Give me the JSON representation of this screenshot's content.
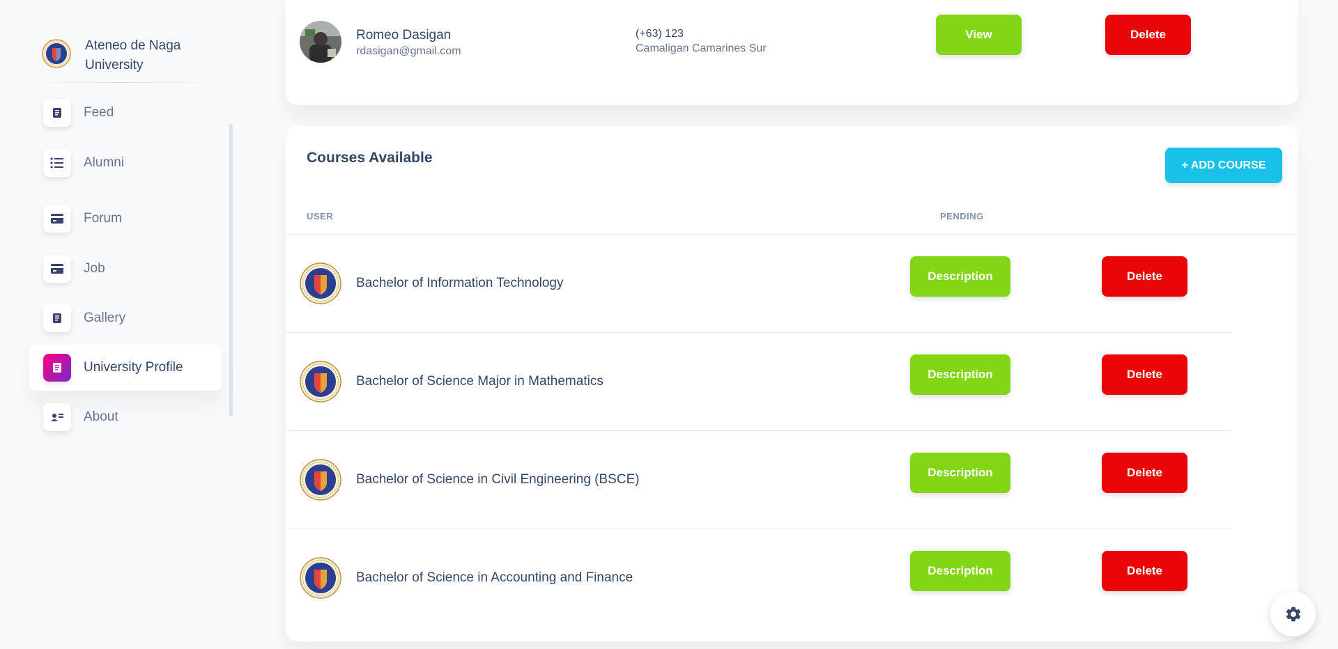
{
  "brand": {
    "name": "Ateneo de Naga University"
  },
  "sidebar": {
    "items": [
      {
        "label": "Feed",
        "icon": "document-icon",
        "active": false
      },
      {
        "label": "Alumni",
        "icon": "list-icon",
        "active": false
      },
      {
        "label": "Forum",
        "icon": "credit-card-icon",
        "active": false
      },
      {
        "label": "Job",
        "icon": "credit-card-icon",
        "active": false
      },
      {
        "label": "Gallery",
        "icon": "document-icon",
        "active": false
      },
      {
        "label": "University Profile",
        "icon": "document-icon",
        "active": true
      },
      {
        "label": "About",
        "icon": "contact-card-icon",
        "active": false
      }
    ]
  },
  "alumni_row": {
    "name": "Romeo Dasigan",
    "email": "rdasigan@gmail.com",
    "phone": "(+63) 123",
    "address": "Camaligan Camarines Sur",
    "view_label": "View",
    "delete_label": "Delete"
  },
  "courses": {
    "title": "Courses Available",
    "add_label": "+ ADD COURSE",
    "headers": {
      "user": "USER",
      "pending": "PENDING"
    },
    "rows": [
      {
        "name": "Bachelor of Information Technology",
        "description_label": "Description",
        "delete_label": "Delete"
      },
      {
        "name": "Bachelor of Science Major in Mathematics",
        "description_label": "Description",
        "delete_label": "Delete"
      },
      {
        "name": "Bachelor of Science in Civil Engineering (BSCE)",
        "description_label": "Description",
        "delete_label": "Delete"
      },
      {
        "name": "Bachelor of Science in Accounting and Finance",
        "description_label": "Description",
        "delete_label": "Delete"
      }
    ]
  },
  "colors": {
    "green": "#82d616",
    "red": "#ea0606",
    "cyan": "#17c1e8",
    "active_gradient_start": "#7928ca",
    "active_gradient_end": "#ff0080",
    "text_dark": "#344767",
    "text_muted": "#67748e"
  },
  "settings": {
    "icon": "gear-icon"
  }
}
